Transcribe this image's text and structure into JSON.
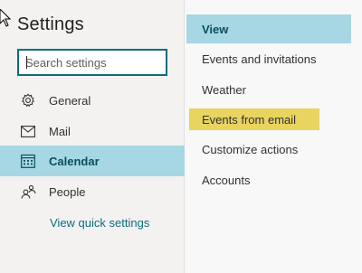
{
  "settings": {
    "title": "Settings",
    "search": {
      "placeholder": "Search settings",
      "value": ""
    },
    "nav": [
      {
        "label": "General",
        "icon": "gear-icon",
        "selected": false
      },
      {
        "label": "Mail",
        "icon": "mail-icon",
        "selected": false
      },
      {
        "label": "Calendar",
        "icon": "calendar-icon",
        "selected": true
      },
      {
        "label": "People",
        "icon": "people-icon",
        "selected": false
      }
    ],
    "quick_settings_link": "View quick settings"
  },
  "calendar_menu": {
    "items": [
      {
        "label": "View",
        "state": "selected"
      },
      {
        "label": "Events and invitations",
        "state": "normal"
      },
      {
        "label": "Weather",
        "state": "normal"
      },
      {
        "label": "Events from email",
        "state": "highlighted"
      },
      {
        "label": "Customize actions",
        "state": "normal"
      },
      {
        "label": "Accounts",
        "state": "normal"
      }
    ]
  },
  "colors": {
    "selected_bg": "#a6d7e3",
    "selected_text": "#0b4f5c",
    "highlight_bg": "#e9d45f",
    "accent": "#0f6c7d",
    "left_pane_bg": "#f3f2f1"
  }
}
